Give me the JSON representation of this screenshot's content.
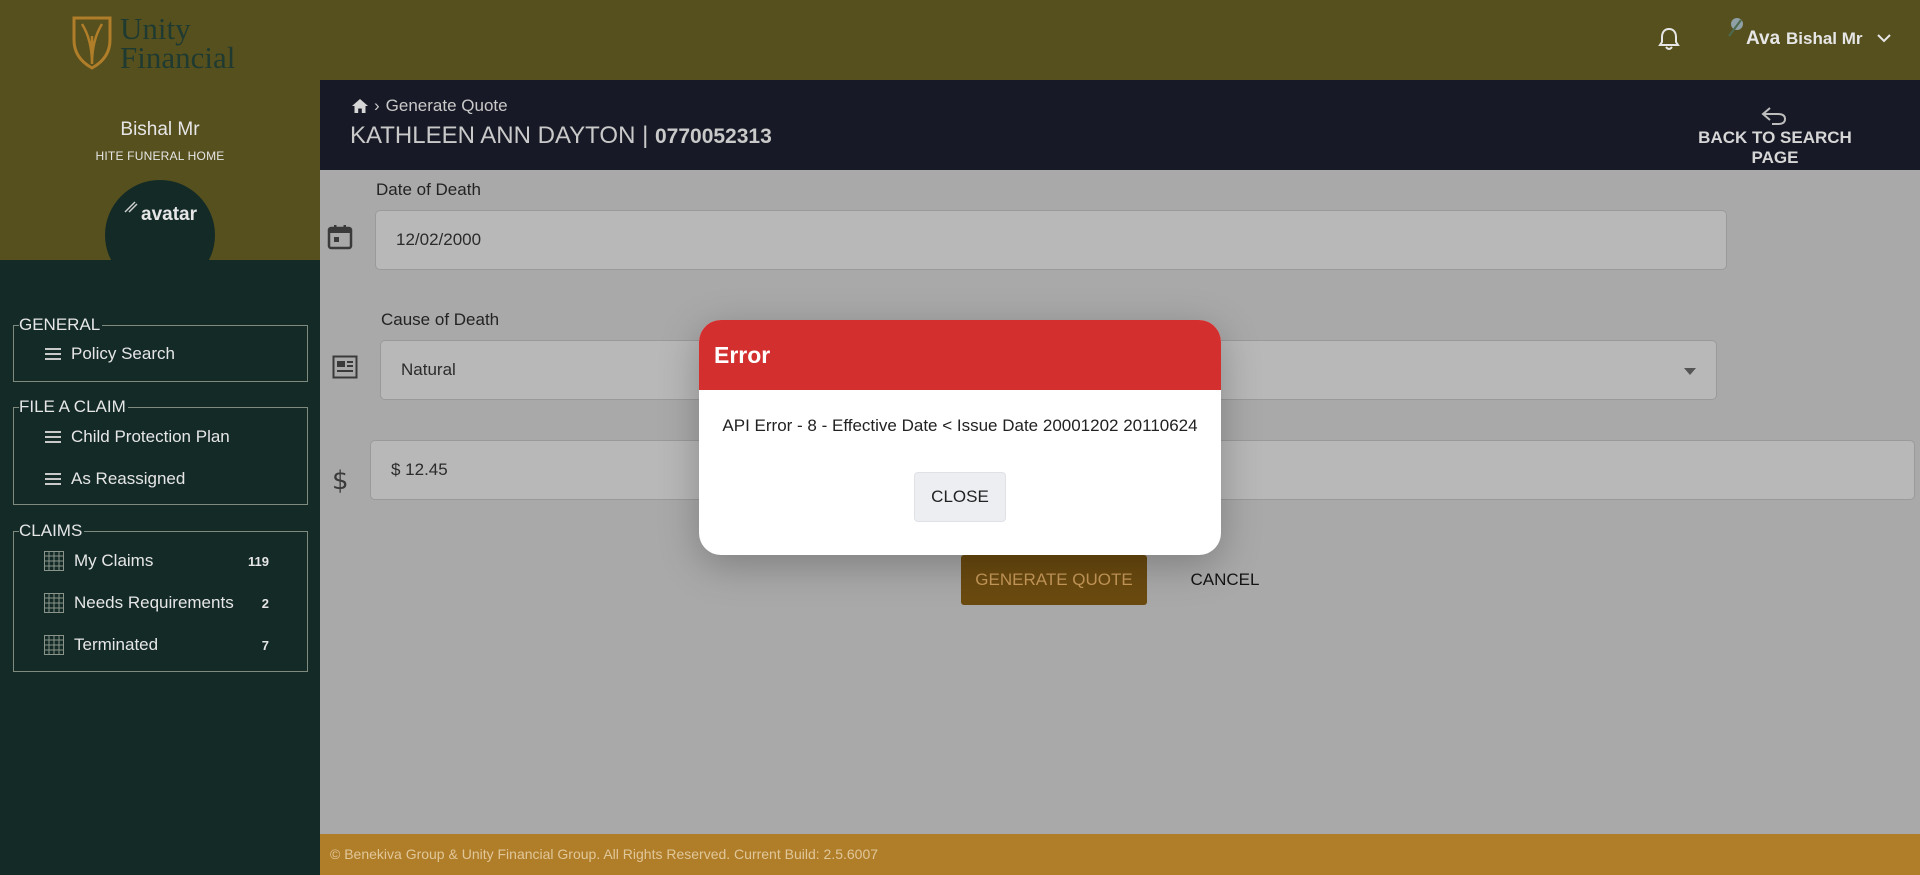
{
  "brand": {
    "logo_text_line1": "Unity",
    "logo_text_line2": "Financial"
  },
  "user": {
    "name": "Bishal Mr",
    "organization": "HITE FUNERAL HOME",
    "avatar_alt": "avatar",
    "top_avatar_alt": "Ava",
    "top_name": "Bishal Mr"
  },
  "sidebar": {
    "groups": [
      {
        "title": "GENERAL",
        "items": [
          {
            "label": "Policy Search",
            "icon": "list-icon"
          }
        ]
      },
      {
        "title": "FILE A CLAIM",
        "items": [
          {
            "label": "Child Protection Plan",
            "icon": "list-icon"
          },
          {
            "label": "As Reassigned",
            "icon": "list-icon"
          }
        ]
      },
      {
        "title": "CLAIMS",
        "items": [
          {
            "label": "My Claims",
            "icon": "table-icon",
            "count": "119"
          },
          {
            "label": "Needs Requirements",
            "icon": "table-icon",
            "count": "2"
          },
          {
            "label": "Terminated",
            "icon": "table-icon",
            "count": "7"
          }
        ]
      }
    ]
  },
  "header": {
    "breadcrumb": "Generate Quote",
    "claimant_name": "KATHLEEN ANN DAYTON",
    "separator": "|",
    "policy_number": "0770052313",
    "back_label": "BACK TO SEARCH PAGE"
  },
  "form": {
    "date_of_death_label": "Date of Death",
    "date_of_death_value": "12/02/2000",
    "cause_of_death_label": "Cause of Death",
    "cause_of_death_value": "Natural",
    "amount_value": "$ 12.45",
    "generate_label": "GENERATE QUOTE",
    "cancel_label": "CANCEL"
  },
  "dialog": {
    "title": "Error",
    "message": "API Error - 8 - Effective Date < Issue Date 20001202 20110624",
    "close_label": "CLOSE"
  },
  "footer": {
    "text": "© Benekiva Group & Unity Financial Group. All Rights Reserved. Current Build: 2.5.6007"
  },
  "colors": {
    "sidebar_bg": "#132a27",
    "topbar_bg": "#56501e",
    "header_bg": "#171a26",
    "footer_bg": "#b07d28",
    "error_red": "#d32f2f",
    "button_brown": "#6a4a0f"
  }
}
